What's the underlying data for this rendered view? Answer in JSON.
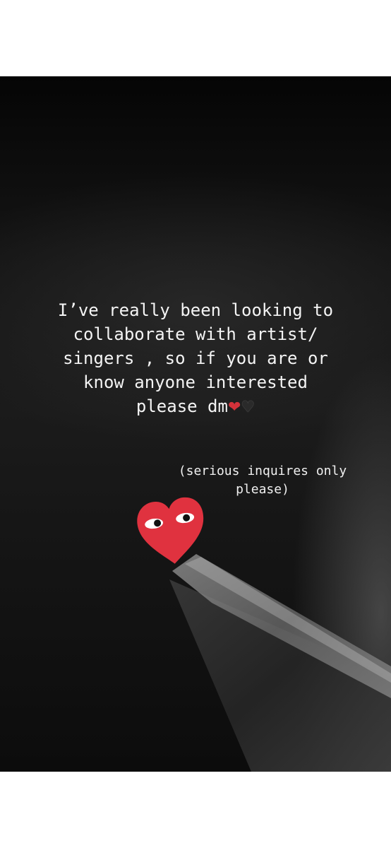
{
  "story": {
    "caption_lines": [
      "I’ve really been looking to",
      "collaborate with artist/",
      "singers , so if you are or",
      "know anyone interested",
      "please dm"
    ],
    "caption_hearts": [
      "❤",
      "♥"
    ],
    "note_lines": [
      "(serious inquires only",
      "please)"
    ],
    "sticker": {
      "icon": "heart-with-eyes-icon",
      "color": "#e0323f"
    }
  }
}
